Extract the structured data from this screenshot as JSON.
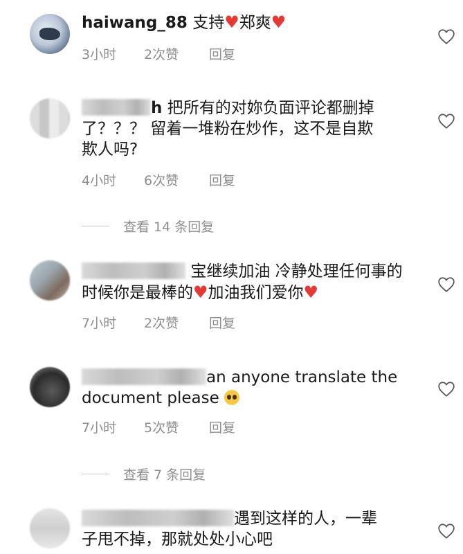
{
  "comments": [
    {
      "username": "haiwang_88",
      "text_parts": [
        "支持",
        "郑爽",
        ""
      ],
      "time": "3小时",
      "likes": "2次赞",
      "reply": "回复"
    },
    {
      "username_tail": "h",
      "line1": "把所有的对妳负面评论都删掉",
      "line2": "了？？？ 留着一堆粉在炒作，这不是自欺",
      "line3": "欺人吗?",
      "time": "4小时",
      "likes": "6次赞",
      "reply": "回复",
      "view_replies": "查看 14 条回复"
    },
    {
      "line1": "宝继续加油 冷静处理任何事的",
      "line2a": "时候你是最棒的",
      "line2b": "加油我们爱你",
      "time": "7小时",
      "likes": "2次赞",
      "reply": "回复"
    },
    {
      "line1": "an anyone translate the",
      "line2": "document please",
      "time": "7小时",
      "likes": "5次赞",
      "reply": "回复",
      "view_replies": "查看 7 条回复"
    },
    {
      "line1": "遇到这样的人，一辈",
      "line2": "子甩不掉，那就处处小心吧"
    }
  ],
  "icons": {
    "heart_emoji": "red-heart",
    "like": "heart-outline-icon",
    "pleading": "pleading-face-emoji"
  },
  "colors": {
    "meta": "#8e8e8e",
    "heart": "#e53935"
  }
}
